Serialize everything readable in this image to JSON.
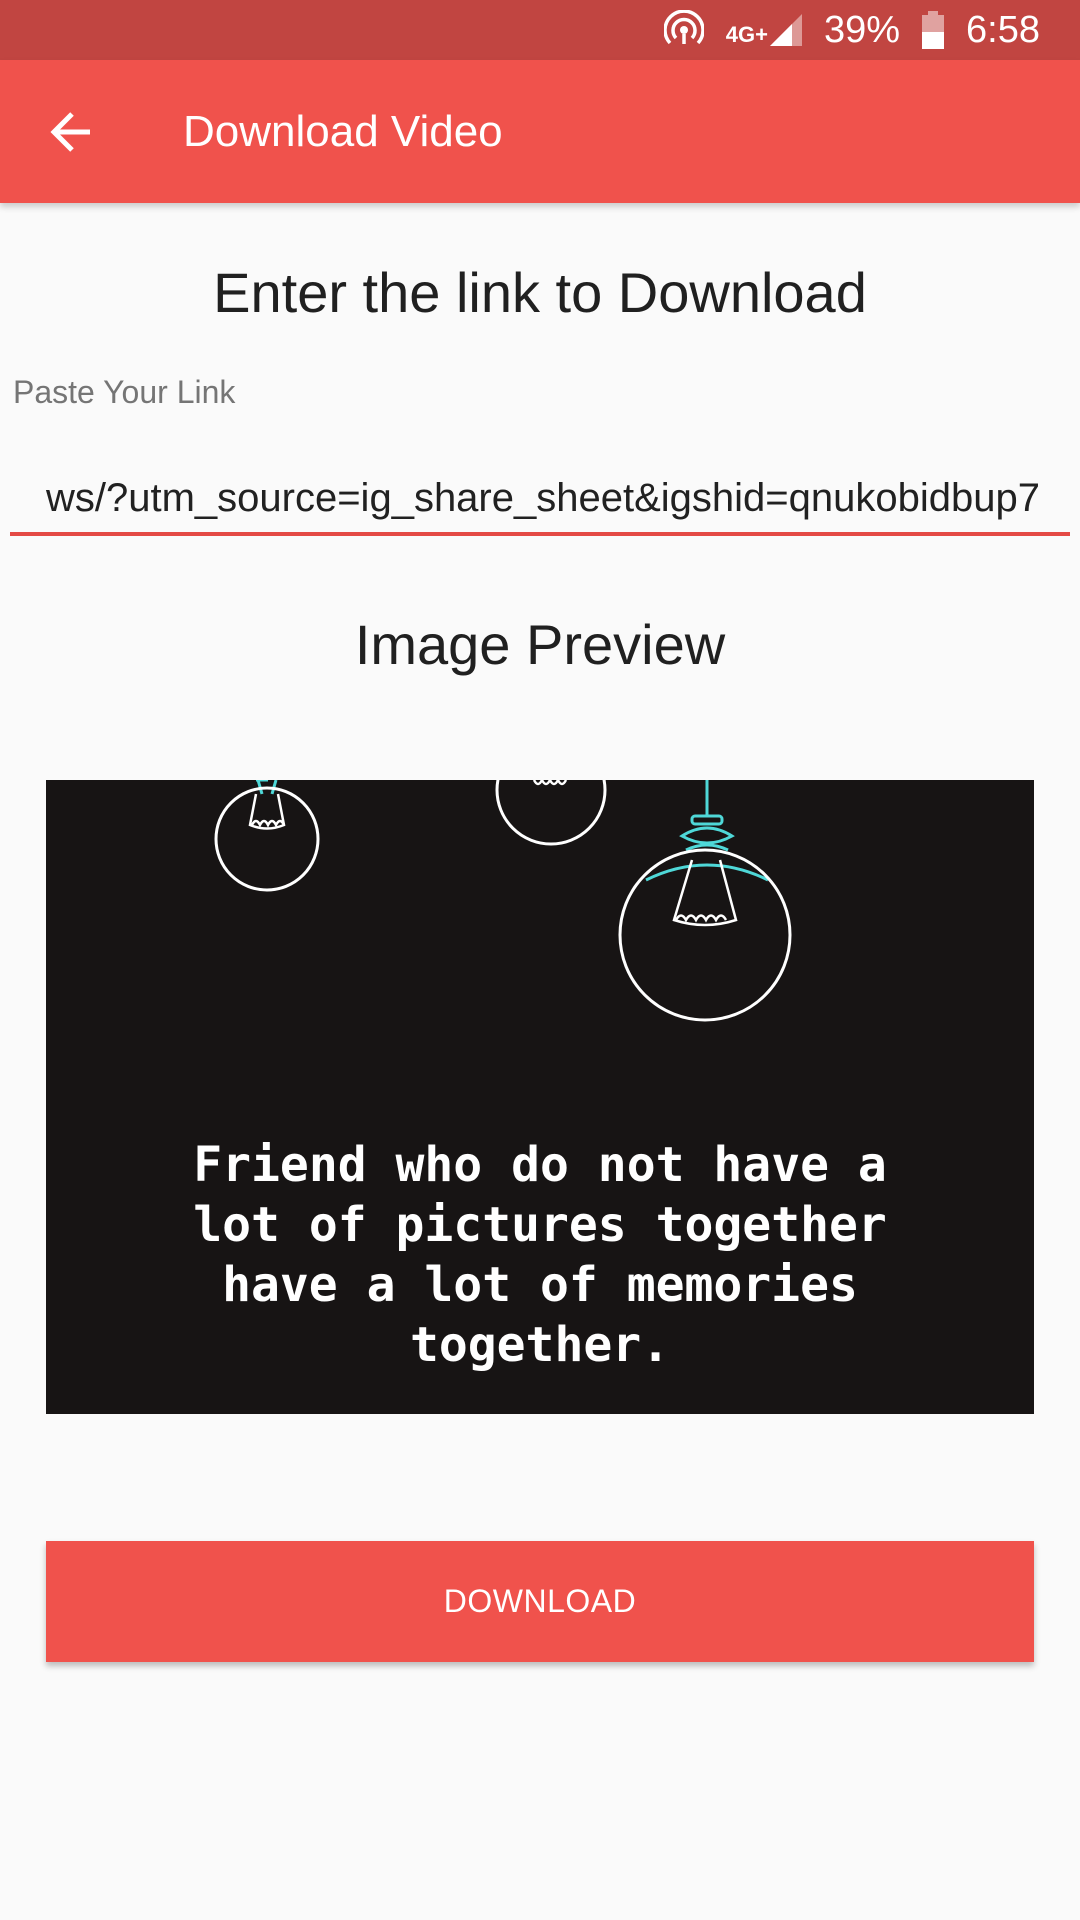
{
  "status_bar": {
    "network_type": "4G+",
    "battery": "39%",
    "time": "6:58",
    "icons": [
      "hotspot-icon",
      "signal-icon",
      "battery-icon"
    ]
  },
  "app_bar": {
    "title": "Download Video",
    "back_icon": "arrow-back-icon",
    "color": "#f0524c"
  },
  "main": {
    "heading": "Enter the link to Download",
    "input_label": "Paste Your Link",
    "link_value": "ws/?utm_source=ig_share_sheet&igshid=qnukobidbup7",
    "preview_heading": "Image Preview",
    "preview_quote": "Friend who do not have a lot of pictures together have a lot of memories together.",
    "download_label": "DOWNLOAD"
  },
  "colors": {
    "accent": "#f0524c",
    "status_bar": "#c14541"
  }
}
